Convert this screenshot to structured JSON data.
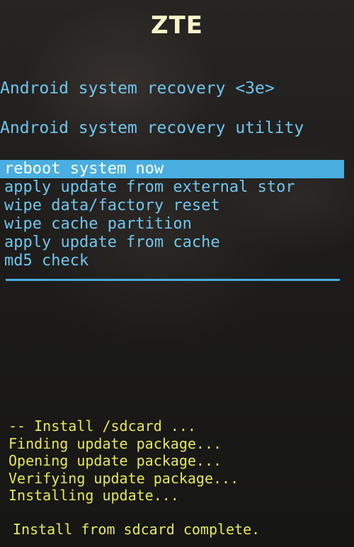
{
  "brand": "ZTE",
  "recovery": {
    "title": "Android system recovery <3e>",
    "subtitle": "Android system recovery utility",
    "menu": [
      {
        "label": "reboot system now",
        "selected": true
      },
      {
        "label": "apply update from external stor",
        "selected": false
      },
      {
        "label": "wipe data/factory reset",
        "selected": false
      },
      {
        "label": "wipe cache partition",
        "selected": false
      },
      {
        "label": "apply update from cache",
        "selected": false
      },
      {
        "label": "md5 check",
        "selected": false
      }
    ]
  },
  "log": {
    "lines": [
      "-- Install /sdcard ...",
      "Finding update package...",
      "Opening update package...",
      "Verifying update package...",
      "Installing update..."
    ],
    "final": "Install from sdcard complete."
  },
  "colors": {
    "menu_text": "#6fc6ee",
    "highlight": "#4aaee0",
    "log_text": "#e7e85a",
    "brand_text": "#f6f3c8"
  }
}
